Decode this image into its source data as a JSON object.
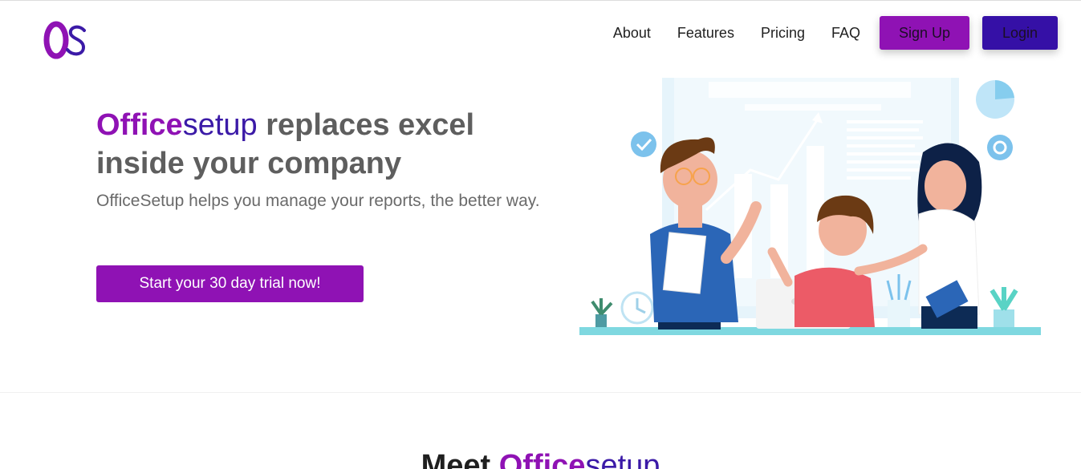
{
  "logo": {
    "text": "OS",
    "icon": "os-logo"
  },
  "nav": {
    "items": [
      {
        "label": "About"
      },
      {
        "label": "Features"
      },
      {
        "label": "Pricing"
      },
      {
        "label": "FAQ"
      }
    ],
    "signup_label": "Sign Up",
    "login_label": "Login"
  },
  "hero": {
    "title_brand_a": "Office",
    "title_brand_b": "setup",
    "title_rest": " replaces excel inside your company",
    "subtitle": "OfficeSetup helps you manage your reports, the better way.",
    "cta_label": "Start your 30 day trial now!"
  },
  "section": {
    "title_prefix": "Meet ",
    "title_brand_a": "Office",
    "title_brand_b": "setup"
  },
  "colors": {
    "brand_purple": "#8f12b4",
    "brand_indigo": "#3510a6",
    "text_gray": "#5e5e5e"
  }
}
